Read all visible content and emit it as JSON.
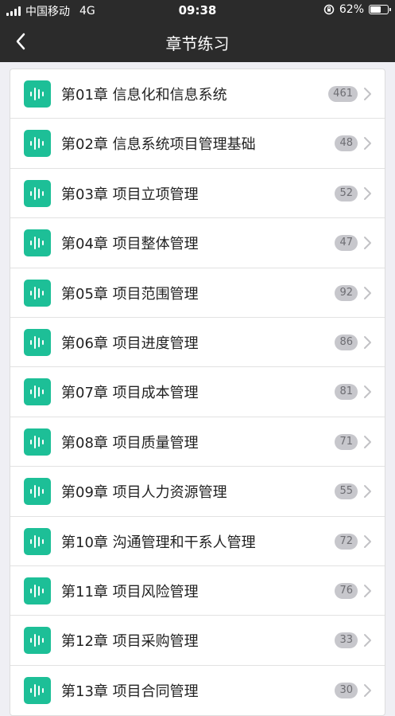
{
  "status_bar": {
    "carrier": "中国移动",
    "network": "4G",
    "time": "09:38",
    "battery_percent": "62%",
    "battery_level": 0.62
  },
  "nav": {
    "title": "章节练习",
    "back_icon": "chevron-left-icon"
  },
  "colors": {
    "accent": "#1dbf97",
    "bar_bg": "#2b2b2b",
    "badge_bg": "#c7c7cc"
  },
  "chapters": [
    {
      "label": "第01章 信息化和信息系统",
      "count": "461"
    },
    {
      "label": "第02章 信息系统项目管理基础",
      "count": "48"
    },
    {
      "label": "第03章 项目立项管理",
      "count": "52"
    },
    {
      "label": "第04章 项目整体管理",
      "count": "47"
    },
    {
      "label": "第05章 项目范围管理",
      "count": "92"
    },
    {
      "label": "第06章 项目进度管理",
      "count": "86"
    },
    {
      "label": "第07章 项目成本管理",
      "count": "81"
    },
    {
      "label": "第08章 项目质量管理",
      "count": "71"
    },
    {
      "label": "第09章 项目人力资源管理",
      "count": "55"
    },
    {
      "label": "第10章 沟通管理和干系人管理",
      "count": "72"
    },
    {
      "label": "第11章 项目风险管理",
      "count": "76"
    },
    {
      "label": "第12章 项目采购管理",
      "count": "33"
    },
    {
      "label": "第13章 项目合同管理",
      "count": "30"
    }
  ]
}
